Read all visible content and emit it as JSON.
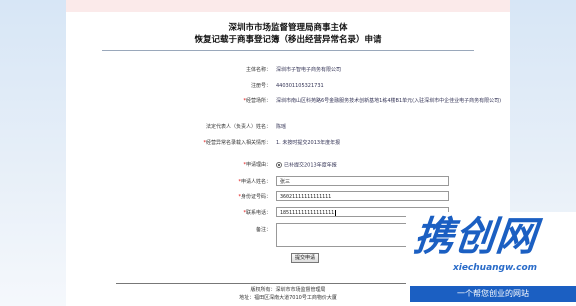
{
  "header": {
    "title_line1": "深圳市市场监督管理局商事主体",
    "title_line2": "恢复记载于商事登记簿（移出经营异常名录）申请"
  },
  "info": {
    "entity_name_label": "主体名称：",
    "entity_name_value": "深圳市子智电子商务有限公司",
    "reg_no_label": "注册号：",
    "reg_no_value": "440301105321731",
    "address_label": "经营场所：",
    "address_value": "深圳市南山区科苑路6号金融服务技术创新基地1栋4楼B1单元(入驻深圳市中企佳业电子商务有限公司)",
    "legal_rep_label": "法定代表人（负责人）姓名：",
    "legal_rep_value": "陈瑶",
    "reason_label": "经营异常名录载入相关情形：",
    "reason_value": "1. 未按时提交2013年度年报"
  },
  "form": {
    "apply_reason_label": "申请理由：",
    "apply_reason_option": "已补提交2013年度年报",
    "applicant_name_label": "申请人姓名：",
    "applicant_name_value": "张三",
    "id_label": "身份证号码：",
    "id_value": "36021111111111111",
    "phone_label": "联系电话：",
    "phone_value": "185111111111111111",
    "remark_label": "备注：",
    "submit_label": "提交申请"
  },
  "footer": {
    "line1": "版权所有：深圳市市场监督管理局",
    "line2": "地址：福田区深南大道7010号工商物价大厦"
  },
  "watermark": {
    "logo_text": "携创网",
    "url": "xiechuangw.com",
    "tagline": "一个帮您创业的网站"
  },
  "colors": {
    "required_star": "#dd0000",
    "watermark_blue": "#1b5fc2"
  }
}
